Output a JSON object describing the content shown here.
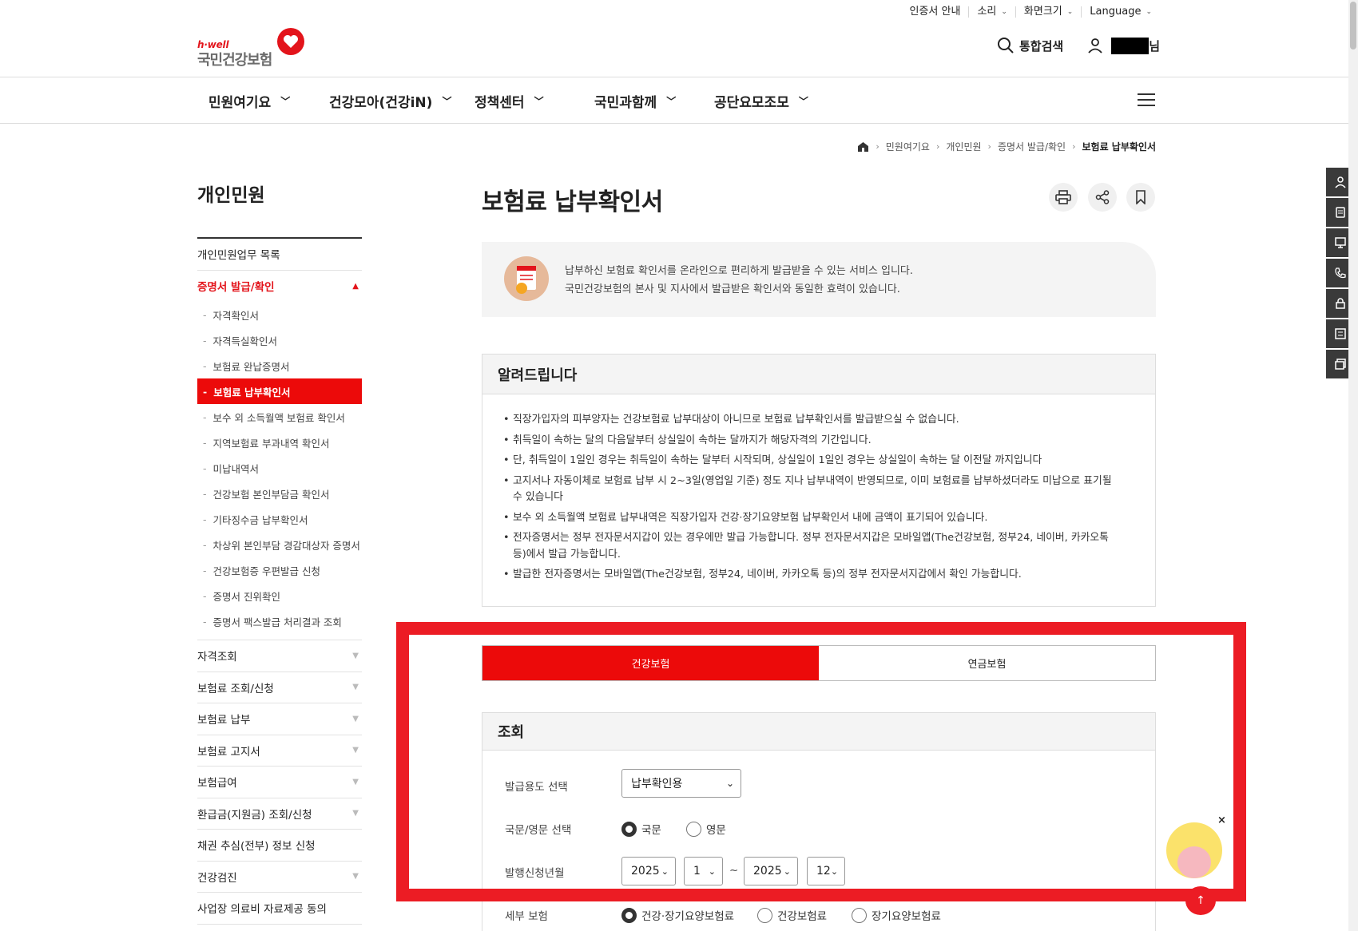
{
  "utility": {
    "cert_guide": "인증서 안내",
    "sound": "소리",
    "screen_size": "화면크기",
    "language": "Language"
  },
  "logo": {
    "tagline": "h·well",
    "name": "국민건강보험"
  },
  "header": {
    "search_label": "통합검색",
    "user_suffix": "님"
  },
  "gnb": [
    "민원여기요",
    "건강모아(건강iN)",
    "정책센터",
    "국민과함께",
    "공단요모조모"
  ],
  "breadcrumb": {
    "items": [
      "민원여기요",
      "개인민원",
      "증명서 발급/확인"
    ],
    "current": "보험료 납부확인서"
  },
  "sidebar": {
    "title": "개인민원",
    "top_item": "개인민원업무 목록",
    "active_group": "증명서 발급/확인",
    "sub_items": [
      "자격확인서",
      "자격득실확인서",
      "보험료 완납증명서",
      "보험료 납부확인서",
      "보수 외 소득월액 보험료 확인서",
      "지역보험료 부과내역 확인서",
      "미납내역서",
      "건강보험 본인부담금 확인서",
      "기타징수금 납부확인서",
      "차상위 본인부담 경감대상자 증명서",
      "건강보험증 우편발급 신청",
      "증명서 진위확인",
      "증명서 팩스발급 처리결과 조회"
    ],
    "groups": [
      "자격조회",
      "보험료 조회/신청",
      "보험료 납부",
      "보험료 고지서",
      "보험급여",
      "환급금(지원금) 조회/신청",
      "채권 추심(전부) 정보 신청",
      "건강검진",
      "사업장 의료비 자료제공 동의"
    ]
  },
  "page": {
    "title": "보험료 납부확인서",
    "intro_line1": "납부하신 보험료 확인서를 온라인으로 편리하게 발급받을 수 있는 서비스 입니다.",
    "intro_line2": "국민건강보험의 본사 및 지사에서 발급받은 확인서와 동일한 효력이 있습니다."
  },
  "notice": {
    "heading": "알려드립니다",
    "items": [
      "직장가입자의 피부양자는 건강보험료 납부대상이 아니므로 보험료 납부확인서를 발급받으실 수 없습니다.",
      "취득일이 속하는 달의 다음달부터 상실일이 속하는 달까지가 해당자격의 기간입니다.",
      "단, 취득일이 1일인 경우는 취득일이 속하는 달부터 시작되며, 상실일이 1일인 경우는 상실일이 속하는 달 이전달 까지입니다",
      "고지서나 자동이체로 보험료 납부 시 2~3일(영업일 기준) 정도 지나 납부내역이 반영되므로, 이미 보험료를 납부하셨더라도 미납으로 표기될 수 있습니다",
      "보수 외 소득월액 보험료 납부내역은 직장가입자 건강·장기요양보험 납부확인서 내에 금액이 표기되어 있습니다.",
      "전자증명서는 정부 전자문서지갑이 있는 경우에만 발급 가능합니다. 정부 전자문서지갑은 모바일앱(The건강보험, 정부24, 네이버, 카카오톡 등)에서 발급 가능합니다.",
      "발급한 전자증명서는 모바일앱(The건강보험, 정부24, 네이버, 카카오톡 등)의 정부 전자문서지갑에서 확인 가능합니다."
    ]
  },
  "tabs": {
    "health": "건강보험",
    "pension": "연금보험"
  },
  "query": {
    "heading": "조회",
    "purpose_label": "발급용도 선택",
    "purpose_value": "납부확인용",
    "lang_label": "국문/영문 선택",
    "lang_kor": "국문",
    "lang_eng": "영문",
    "period_label": "발행신청년월",
    "from_year": "2025",
    "from_month": "1",
    "tilde": "~",
    "to_year": "2025",
    "to_month": "12",
    "detail_label": "세부 보험",
    "detail_opt1": "건강·장기요양보험료",
    "detail_opt2": "건강보험료",
    "detail_opt3": "장기요양보험료"
  },
  "chatbot": {
    "close": "×"
  },
  "top_button": {
    "label": "↑"
  }
}
